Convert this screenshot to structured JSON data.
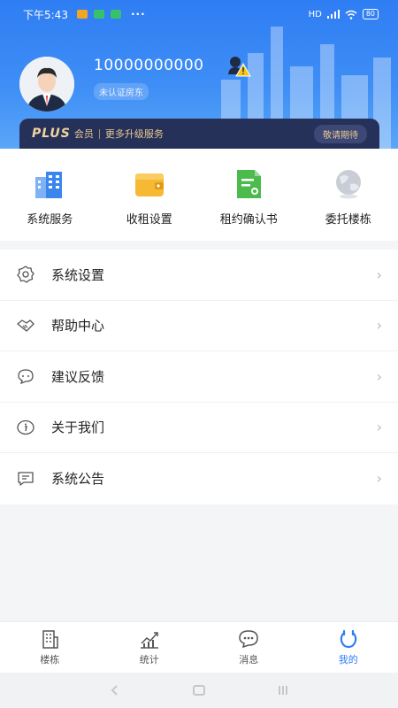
{
  "status_bar": {
    "time": "下午5:43",
    "network": "HD",
    "battery": "80"
  },
  "profile": {
    "phone": "10000000000",
    "status": "未认证房东"
  },
  "plus": {
    "logo": "PLUS",
    "member": "会员",
    "slogan": "更多升级服务",
    "button": "敬请期待"
  },
  "quick_actions": [
    {
      "label": "系统服务",
      "icon": "buildings-icon"
    },
    {
      "label": "收租设置",
      "icon": "wallet-icon"
    },
    {
      "label": "租约确认书",
      "icon": "document-icon"
    },
    {
      "label": "委托楼栋",
      "icon": "globe-icon"
    }
  ],
  "menu": [
    {
      "label": "系统设置",
      "icon": "gear-icon"
    },
    {
      "label": "帮助中心",
      "icon": "handshake-icon"
    },
    {
      "label": "建议反馈",
      "icon": "chat-icon"
    },
    {
      "label": "关于我们",
      "icon": "info-icon"
    },
    {
      "label": "系统公告",
      "icon": "announcement-icon"
    }
  ],
  "chevron": "›",
  "tabs": [
    {
      "label": "楼栋",
      "icon": "building-icon"
    },
    {
      "label": "统计",
      "icon": "chart-icon"
    },
    {
      "label": "消息",
      "icon": "message-icon"
    },
    {
      "label": "我的",
      "icon": "profile-icon",
      "active": true
    }
  ],
  "colors": {
    "primary": "#2f7df3",
    "plus_bg": "#26315a",
    "gold": "#e8c990"
  }
}
